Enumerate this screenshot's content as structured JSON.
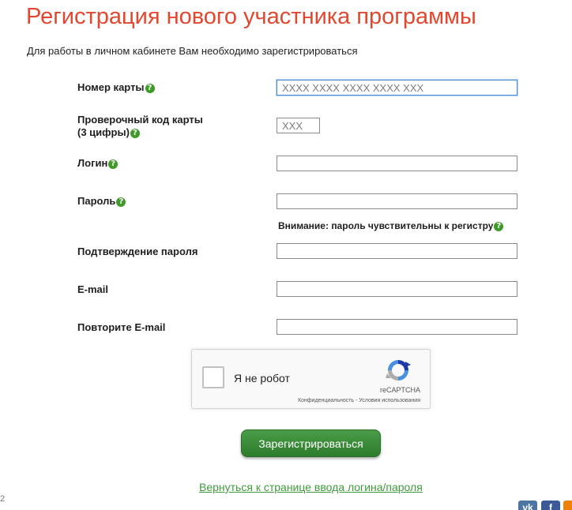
{
  "header": {
    "title": "Регистрация нового участника программы",
    "subtitle": "Для работы в личном кабинете Вам необходимо зарегистрироваться"
  },
  "form": {
    "card_number": {
      "label": "Номер карты",
      "placeholder": "XXXX XXXX XXXX XXXX XXX",
      "value": ""
    },
    "check_code": {
      "label_line1": "Проверочный код карты",
      "label_line2": "(3 цифры)",
      "placeholder": "XXX",
      "value": ""
    },
    "login": {
      "label": "Логин",
      "value": ""
    },
    "password": {
      "label": "Пароль",
      "value": ""
    },
    "password_note": "Внимание: пароль чувствительны к регистру",
    "password_confirm": {
      "label": "Подтверждение пароля",
      "value": ""
    },
    "email": {
      "label": "E-mail",
      "value": ""
    },
    "email_repeat": {
      "label": "Повторите E-mail",
      "value": ""
    },
    "help_icon_glyph": "?"
  },
  "recaptcha": {
    "label": "Я не робот",
    "brand": "reCAPTCHA",
    "terms": "Конфиденциальность - Условия использования"
  },
  "actions": {
    "submit_label": "Зарегистрироваться",
    "back_link": "Вернуться к странице ввода логина/пароля"
  },
  "social": {
    "vk": "vk",
    "fb": "f"
  },
  "edge_mark": "2",
  "colors": {
    "title": "#e2472f",
    "accent_green": "#3f9a2a",
    "button_green": "#3b8e39",
    "link_green": "#3f9a3c",
    "focus_border": "#4a90d9"
  },
  "icons": {
    "help": "question-circle-icon",
    "recaptcha": "recaptcha-logo-icon",
    "vk": "vk-icon",
    "facebook": "facebook-icon",
    "odnoklassniki": "odnoklassniki-icon"
  }
}
